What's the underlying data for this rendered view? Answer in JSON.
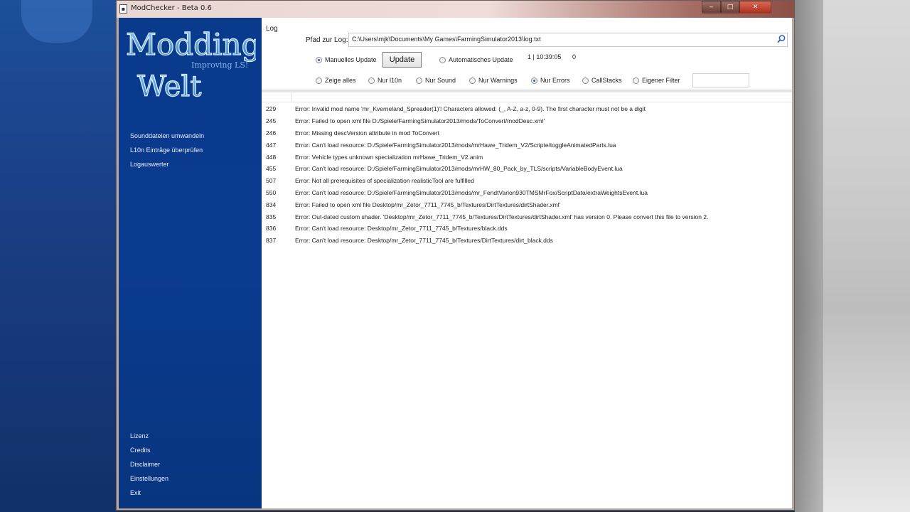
{
  "window": {
    "title": "ModChecker - Beta 0.6",
    "icon": "app-icon",
    "controls": {
      "minimize": "‒",
      "maximize": "□",
      "close": "✕"
    }
  },
  "logo": {
    "line1": "Modding",
    "tagline": "Improving LS!",
    "line2": "Welt"
  },
  "sidebar": {
    "top_items": [
      {
        "label": "Sounddateien umwandeln"
      },
      {
        "label": "L10n Einträge überprüfen"
      },
      {
        "label": "Logauswerter"
      }
    ],
    "bottom_items": [
      {
        "label": "Lizenz"
      },
      {
        "label": "Credits"
      },
      {
        "label": "Disclaimer"
      },
      {
        "label": "Einstellungen"
      },
      {
        "label": "Exit"
      }
    ]
  },
  "log": {
    "section_label": "Log",
    "path_label": "Pfad zur Log:",
    "path_value": "C:\\Users\\mjk\\Documents\\My Games\\FarmingSimulator2013\\log.txt",
    "update_mode": {
      "manual_label": "Manuelles Update",
      "manual_selected": true,
      "update_button": "Update",
      "auto_label": "Automatisches Update",
      "auto_selected": false,
      "status": "1 | 10:39:05",
      "count": "0"
    },
    "filters": [
      {
        "label": "Zeige alles",
        "selected": false
      },
      {
        "label": "Nur l10n",
        "selected": false
      },
      {
        "label": "Nur Sound",
        "selected": false
      },
      {
        "label": "Nur Warnings",
        "selected": false
      },
      {
        "label": "Nur Errors",
        "selected": true
      },
      {
        "label": "CallStacks",
        "selected": false
      },
      {
        "label": "Eigener Filter",
        "selected": false
      }
    ],
    "custom_filter_value": "",
    "entries": [
      {
        "line": "229",
        "message": "Error: Invalid mod name 'mr_Kverneland_Spreader(1)'! Characters allowed: (_, A-Z, a-z, 0-9). The first character must not be a digit"
      },
      {
        "line": "245",
        "message": "Error: Failed to open xml file D:/Spiele/FarmingSimulator2013/mods/ToConvert/modDesc.xml'"
      },
      {
        "line": "246",
        "message": "Error: Missing descVersion attribute in mod ToConvert"
      },
      {
        "line": "447",
        "message": "Error: Can't load resource: D:/Spiele/FarmingSimulator2013/mods/mrHawe_Tridem_V2/Scripte/toggleAnimatedParts.lua"
      },
      {
        "line": "448",
        "message": "Error: Vehicle types unknown specialization mrHawe_Tridem_V2.anim"
      },
      {
        "line": "455",
        "message": "Error: Can't load resource: D:/Spiele/FarmingSimulator2013/mods/mrHW_80_Pack_by_TLS/scripts/VariableBodyEvent.lua"
      },
      {
        "line": "507",
        "message": "Error: Not all prerequisites of specialization realisticTool are fulfilled"
      },
      {
        "line": "550",
        "message": "Error: Can't load resource: D:/Spiele/FarmingSimulator2013/mods/mr_FendtVarion930TMSMrFox/ScriptData/extraWeightsEvent.lua"
      },
      {
        "line": "834",
        "message": "Error: Failed to open xml file Desktop/mr_Zetor_7711_7745_b/Textures/DirtTextures/dirtShader.xml'"
      },
      {
        "line": "835",
        "message": "Error: Out-dated custom shader. 'Desktop/mr_Zetor_7711_7745_b/Textures/DirtTextures/dirtShader.xml' has version 0. Please convert this file to version 2."
      },
      {
        "line": "836",
        "message": "Error: Can't load resource: Desktop/mr_Zetor_7711_7745_b/Textures/black.dds"
      },
      {
        "line": "837",
        "message": "Error: Can't load resource: Desktop/mr_Zetor_7711_7745_b/Textures/DirtTextures/dirt_black.dds"
      }
    ]
  },
  "colors": {
    "sidebar": "#0a3a8c",
    "logo_fill": "#4a9ad8",
    "radio_accent": "#2a5fb0"
  }
}
